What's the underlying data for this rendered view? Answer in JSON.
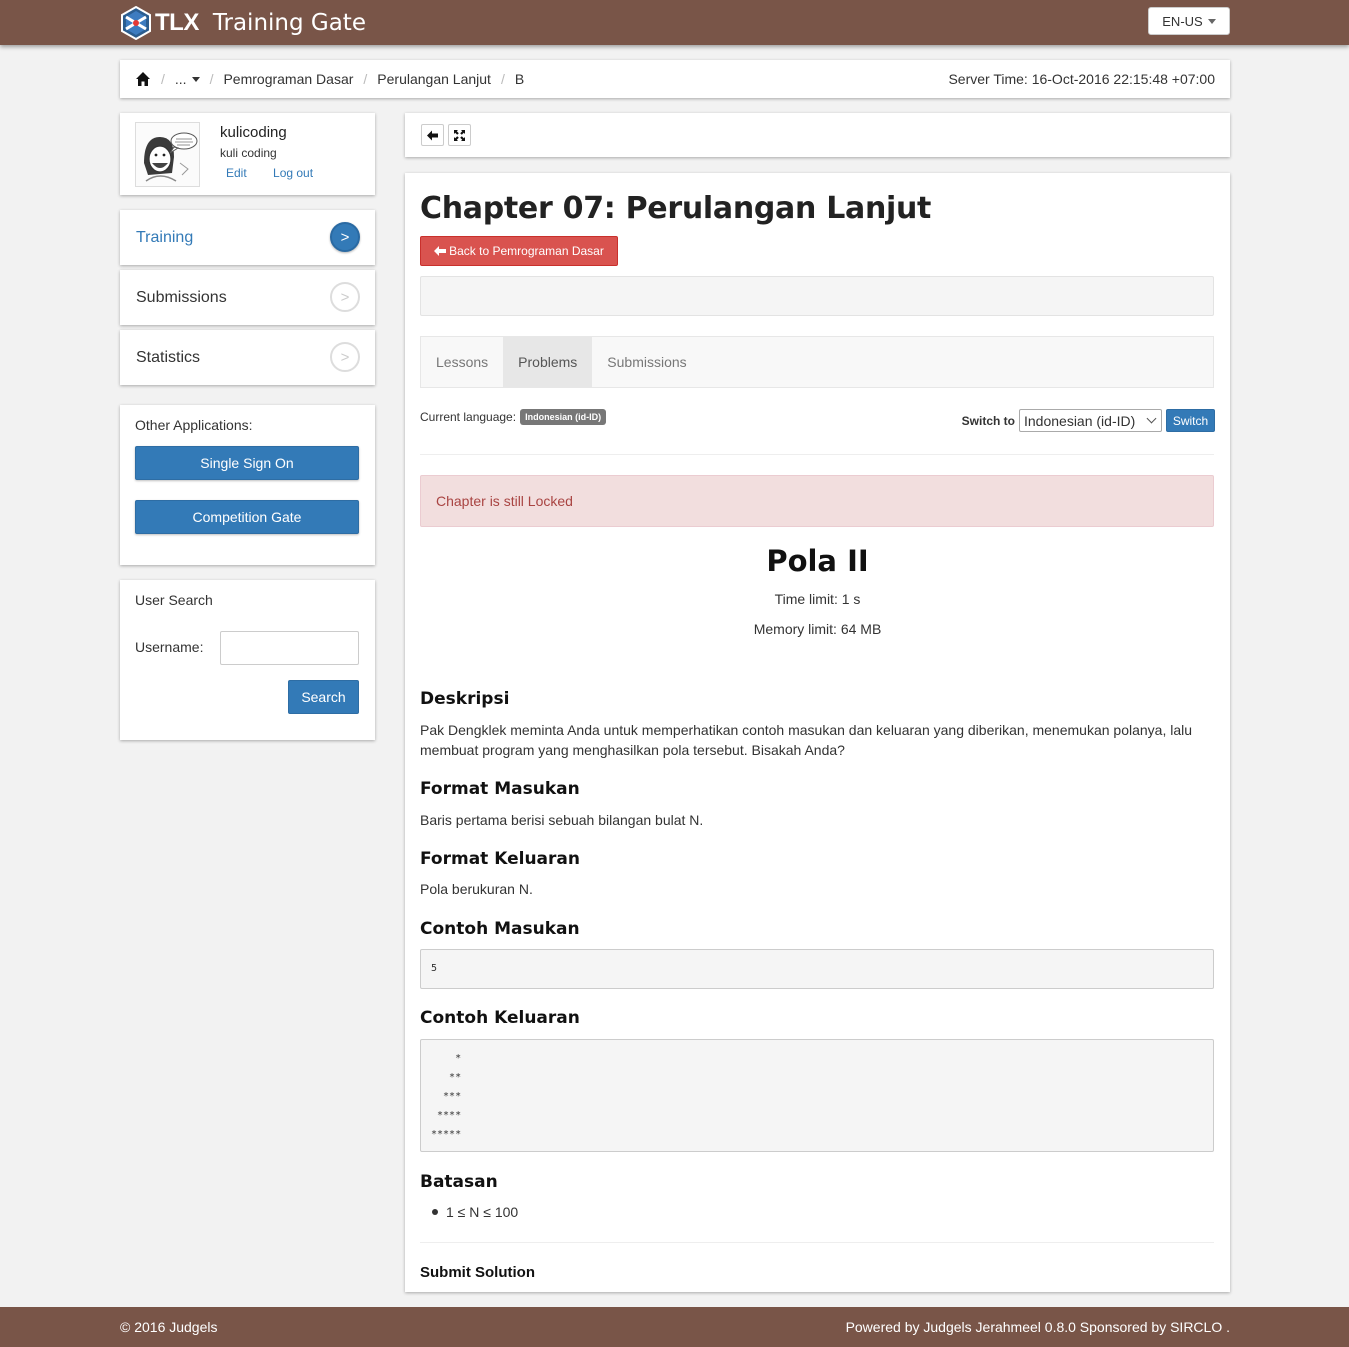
{
  "header": {
    "brand_short": "TLX",
    "brand_title": "Training Gate",
    "language": "EN-US"
  },
  "breadcrumb": {
    "ellipsis": "...",
    "items": [
      "Pemrograman Dasar",
      "Perulangan Lanjut",
      "B"
    ],
    "server_time": "Server Time: 16-Oct-2016 22:15:48 +07:00"
  },
  "user": {
    "username": "kulicoding",
    "fullname": "kuli coding",
    "edit": "Edit",
    "logout": "Log out"
  },
  "sidebar": {
    "nav": [
      {
        "label": "Training",
        "active": true
      },
      {
        "label": "Submissions",
        "active": false
      },
      {
        "label": "Statistics",
        "active": false
      }
    ],
    "nav_arrow": ">",
    "other_apps": {
      "label": "Other Applications:",
      "sso": "Single Sign On",
      "competition": "Competition Gate"
    },
    "user_search": {
      "label": "User Search",
      "username_label": "Username:",
      "username_value": "",
      "search_button": "Search"
    }
  },
  "main": {
    "chapter_title": "Chapter 07: Perulangan Lanjut",
    "back_button": "Back to Pemrograman Dasar",
    "tabs": [
      {
        "label": "Lessons",
        "active": false
      },
      {
        "label": "Problems",
        "active": true
      },
      {
        "label": "Submissions",
        "active": false
      }
    ],
    "current_language_label": "Current language:",
    "current_language_value": "Indonesian (id-ID)",
    "switch_to_label": "Switch to",
    "switch_select_value": "Indonesian (id-ID)",
    "switch_button": "Switch",
    "alert": "Chapter is still Locked",
    "problem": {
      "title": "Pola II",
      "time_limit": "Time limit: 1 s",
      "memory_limit": "Memory limit: 64 MB",
      "deskripsi_heading": "Deskripsi",
      "deskripsi": "Pak Dengklek meminta Anda untuk memperhatikan contoh masukan dan keluaran yang diberikan, menemukan polanya, lalu membuat program yang menghasilkan pola tersebut. Bisakah Anda?",
      "format_masukan_heading": "Format Masukan",
      "format_masukan": "Baris pertama berisi sebuah bilangan bulat N.",
      "format_keluaran_heading": "Format Keluaran",
      "format_keluaran": "Pola berukuran N.",
      "contoh_masukan_heading": "Contoh Masukan",
      "contoh_masukan": "5",
      "contoh_keluaran_heading": "Contoh Keluaran",
      "contoh_keluaran": "    *\n   **\n  ***\n ****\n*****",
      "batasan_heading": "Batasan",
      "batasan_items": [
        "1 ≤ N ≤ 100"
      ]
    },
    "submit_heading": "Submit Solution"
  },
  "footer": {
    "left": "© 2016 Judgels",
    "right": "Powered by Judgels Jerahmeel 0.8.0 Sponsored by SIRCLO ."
  },
  "colors": {
    "topbar": "#795548",
    "primary": "#337ab7",
    "danger": "#d9534f",
    "alert_bg": "#f2dede",
    "alert_text": "#a94442"
  },
  "icons": [
    "tlx-logo",
    "home-icon",
    "caret-down-icon",
    "arrow-left-icon",
    "fullscreen-icon",
    "chevron-right-icon",
    "avatar"
  ]
}
